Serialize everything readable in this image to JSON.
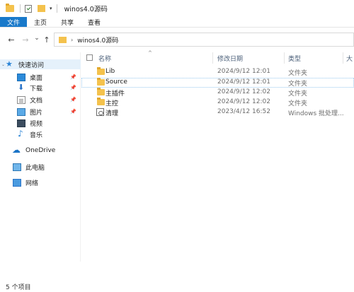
{
  "window": {
    "title": "winos4.0源码"
  },
  "ribbon": {
    "tabs": [
      "文件",
      "主页",
      "共享",
      "查看"
    ]
  },
  "address": {
    "path": "winos4.0源码",
    "separator": "›"
  },
  "nav": {
    "back": "←",
    "forward": "→",
    "dropdown": "⌄",
    "up": "↑",
    "items": [
      {
        "label": "快速访问",
        "icon": "star-icon",
        "pinned": false
      },
      {
        "label": "桌面",
        "icon": "desktop-icon",
        "pinned": true
      },
      {
        "label": "下载",
        "icon": "download-icon",
        "pinned": true
      },
      {
        "label": "文档",
        "icon": "documents-icon",
        "pinned": true
      },
      {
        "label": "图片",
        "icon": "pictures-icon",
        "pinned": true
      },
      {
        "label": "视频",
        "icon": "videos-icon",
        "pinned": false
      },
      {
        "label": "音乐",
        "icon": "music-icon",
        "pinned": false
      },
      {
        "label": "OneDrive",
        "icon": "onedrive-icon",
        "pinned": false
      },
      {
        "label": "此电脑",
        "icon": "this-pc-icon",
        "pinned": false
      },
      {
        "label": "网络",
        "icon": "network-icon",
        "pinned": false
      }
    ]
  },
  "columns": {
    "name": "名称",
    "date": "修改日期",
    "type": "类型",
    "size": "大"
  },
  "files": [
    {
      "name": "Lib",
      "date": "2024/9/12 12:01",
      "type": "文件夹",
      "kind": "folder"
    },
    {
      "name": "Source",
      "date": "2024/9/12 12:01",
      "type": "文件夹",
      "kind": "folder"
    },
    {
      "name": "主插件",
      "date": "2024/9/12 12:02",
      "type": "文件夹",
      "kind": "folder"
    },
    {
      "name": "主控",
      "date": "2024/9/12 12:02",
      "type": "文件夹",
      "kind": "folder"
    },
    {
      "name": "清理",
      "date": "2023/4/12 16:52",
      "type": "Windows 批处理...",
      "kind": "batch"
    }
  ],
  "status": {
    "count": "5 个项目"
  },
  "colors": {
    "accent": "#1979ca",
    "folder": "#f4c24d",
    "selection": "#e5f1fb"
  }
}
